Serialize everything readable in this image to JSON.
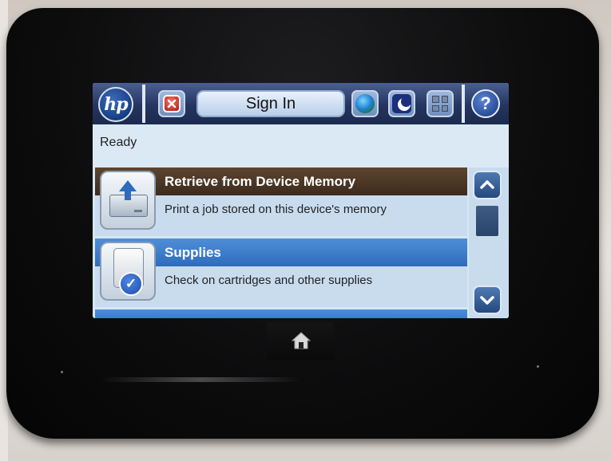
{
  "topbar": {
    "logo_text": "hp",
    "sign_in_label": "Sign In",
    "help_label": "?",
    "icons": [
      "cancel-icon",
      "globe-icon",
      "sleep-moon-icon",
      "network-icon",
      "help-icon"
    ]
  },
  "status": {
    "text": "Ready"
  },
  "list": {
    "items": [
      {
        "title": "Retrieve from Device Memory",
        "description": "Print a job stored on this device's memory",
        "icon": "device-memory-icon",
        "state": "pressed"
      },
      {
        "title": "Supplies",
        "description": "Check on cartridges and other supplies",
        "icon": "supplies-icon",
        "state": "highlighted"
      }
    ]
  },
  "scrollbar": {
    "up_label": "⌃",
    "down_label": "⌄"
  },
  "colors": {
    "topbar": "#24355f",
    "selected_row": "#3e2b1c",
    "highlight_row": "#2f6bbd",
    "screen_bg": "#d6e7f4"
  },
  "hardware": {
    "home_button_icon": "home-icon"
  }
}
